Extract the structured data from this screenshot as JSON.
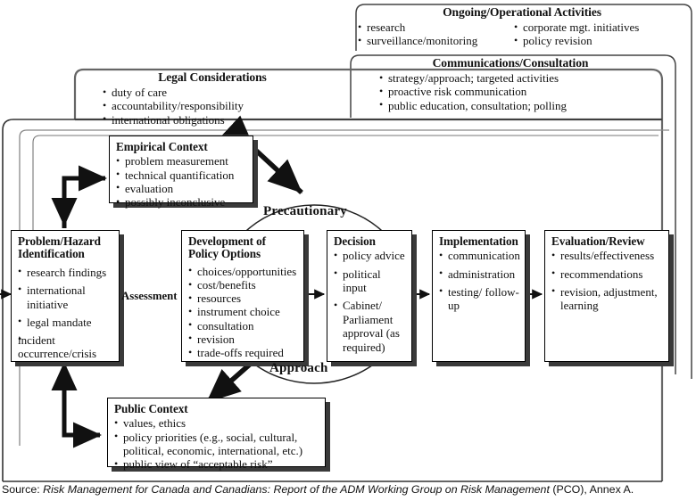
{
  "tabs": [
    {
      "id": "ongoing",
      "title": "Ongoing/Operational Activities",
      "col1": [
        "research",
        "surveillance/monitoring"
      ],
      "col2": [
        "corporate mgt. initiatives",
        "policy revision"
      ]
    },
    {
      "id": "communications",
      "title": "Communications/Consultation",
      "col1": [
        "strategy/approach; targeted activities",
        "proactive risk communication",
        "public education, consultation; polling"
      ],
      "col2": []
    },
    {
      "id": "legal",
      "title": "Legal Considerations",
      "col1": [
        "duty of care",
        "accountability/responsibility",
        "international obligations"
      ],
      "col2": []
    }
  ],
  "nodes": {
    "empirical": {
      "title": "Empirical Context",
      "items": [
        "problem measurement",
        "technical quantification",
        "evaluation",
        "possibly inconclusive"
      ]
    },
    "problem": {
      "title": "Problem/Hazard Identification",
      "items": [
        "research findings",
        "international initiative",
        "legal mandate",
        "incident occurrence/crisis"
      ]
    },
    "development": {
      "title": "Development of Policy Options",
      "items": [
        "choices/opportunities",
        "cost/benefits",
        "resources",
        "instrument choice",
        "consultation",
        "revision",
        "trade-offs required"
      ]
    },
    "decision": {
      "title": "Decision",
      "items": [
        "policy advice",
        "political input",
        "Cabinet/ Parliament approval (as required)"
      ]
    },
    "implementation": {
      "title": "Implementation",
      "items": [
        "communication",
        "administration",
        "testing/ follow-up"
      ]
    },
    "evaluation": {
      "title": "Evaluation/Review",
      "items": [
        "results/effectiveness",
        "recommendations",
        "revision, adjustment, learning"
      ]
    },
    "public": {
      "title": "Public Context",
      "items": [
        "values, ethics",
        "policy priorities (e.g., social, cultural, political, economic, international, etc.)",
        "public view of “acceptable risk”"
      ]
    }
  },
  "labels": {
    "precautionary": "Precautionary",
    "approach": "Approach",
    "assessment": "Assessment"
  },
  "source": {
    "prefix": "Source: ",
    "italic": "Risk Management for Canada and Canadians: Report of the ADM Working Group on Risk Management",
    "suffix": " (PCO), Annex A."
  },
  "colors": {
    "ink": "#111111",
    "frame": "#555555",
    "shadow": "#3a3a3a",
    "background": "#ffffff"
  }
}
